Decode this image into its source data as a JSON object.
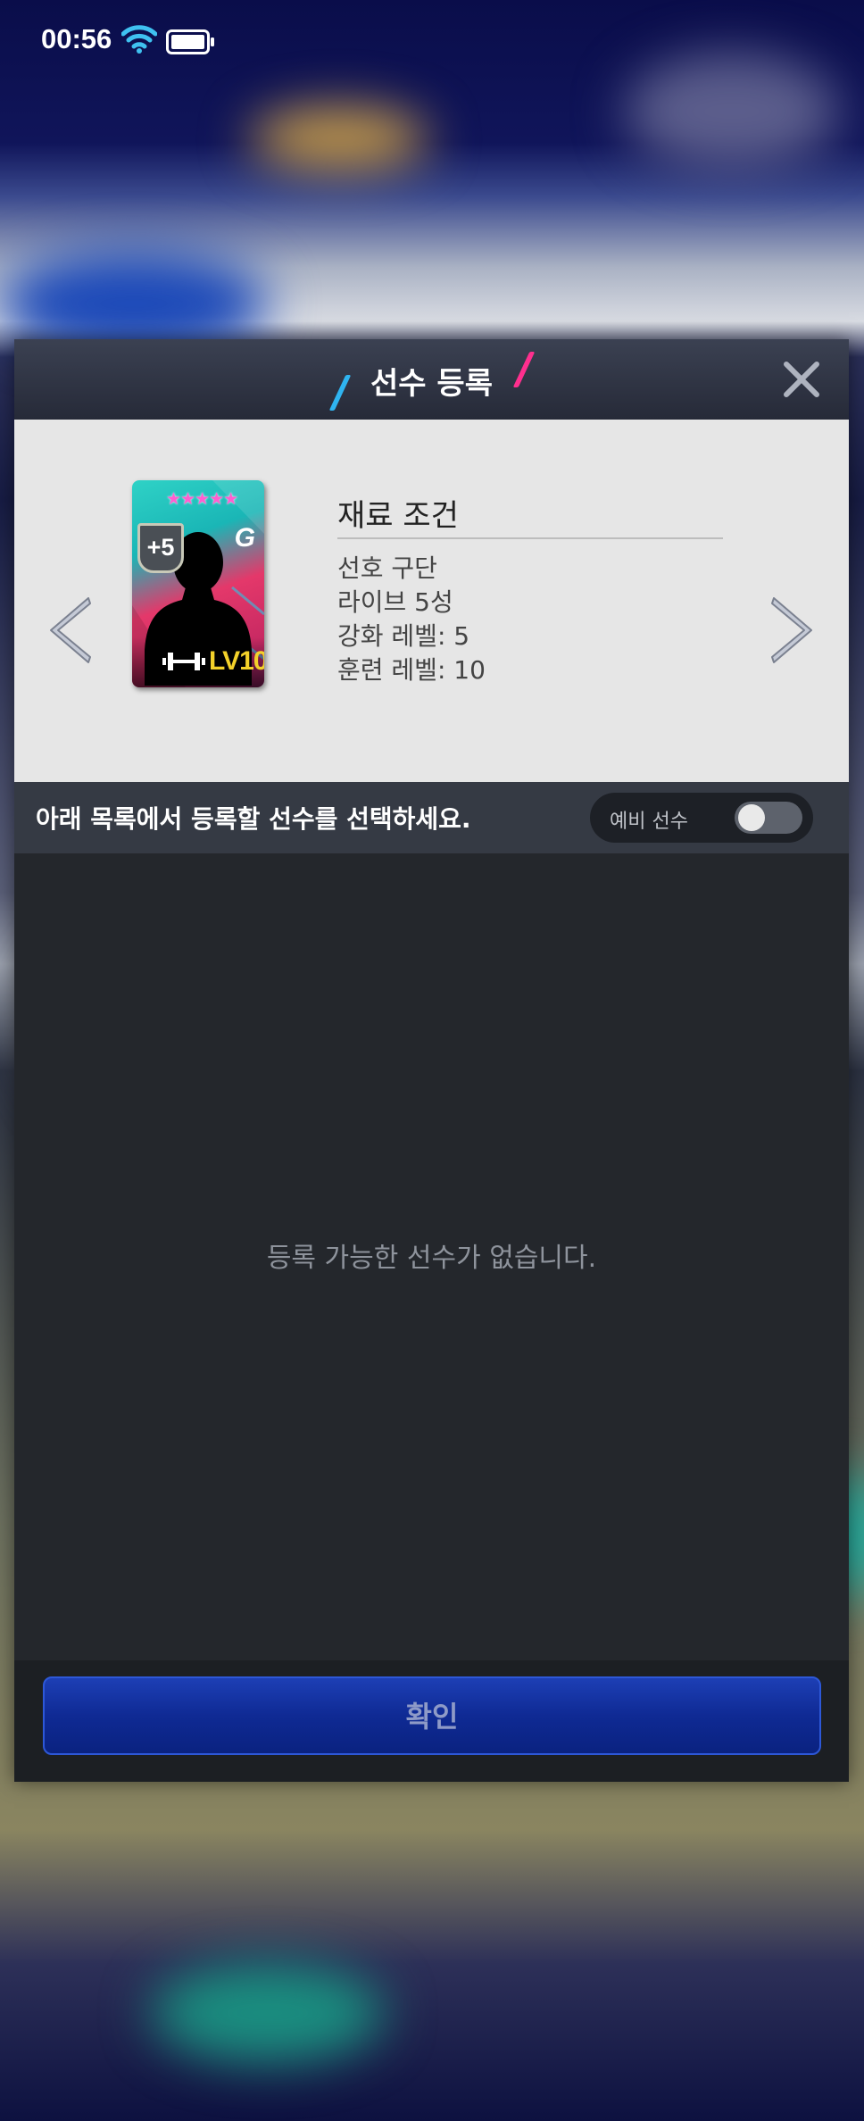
{
  "status_bar": {
    "time": "00:56"
  },
  "dialog": {
    "title": "선수 등록",
    "requirements": {
      "heading": "재료 조건",
      "items": [
        "선호 구단",
        "라이브 5성",
        "강화 레벨: 5",
        "훈련 레벨: 10"
      ]
    },
    "card": {
      "stars": "★★★★★",
      "enhance": "+5",
      "emblem": "G",
      "level": "LV10"
    },
    "instruction": "아래 목록에서 등록할 선수를 선택하세요.",
    "toggle": {
      "label": "예비 선수",
      "on": false
    },
    "empty_message": "등록 가능한 선수가 없습니다.",
    "confirm_label": "확인"
  },
  "colors": {
    "accent_blue": "#2fb4f0",
    "accent_pink": "#ff2f8e",
    "level_gold": "#f3d12a"
  }
}
